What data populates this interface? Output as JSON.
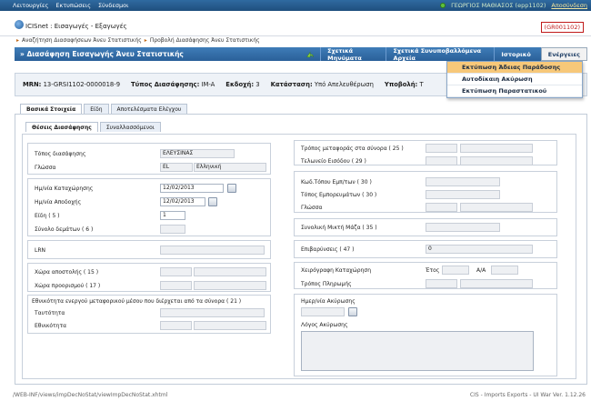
{
  "topbar": {
    "menus": [
      "Λειτουργίες",
      "Εκτυπώσεις",
      "Σύνδεσμοι"
    ],
    "user": "ΓΕΩΡΓΙΟΣ ΜΑΘΙΑΣΟΣ (epp1102)",
    "logout": "Αποσύνδεση"
  },
  "app": {
    "title": "ICISnet : Εισαγωγές - Εξαγωγές",
    "badge": "(GR001102)"
  },
  "breadcrumb": [
    "Αναζήτηση Διασαφήσεων Άνευ Στατιστικής",
    "Προβολή Διασάφησης Άνευ Στατιστικής"
  ],
  "pagebar": {
    "title": "» Διασάφηση Εισαγωγής Άνευ Στατιστικής",
    "buttons": [
      "Σχετικά Μηνύματα",
      "Σχετικά Συνυποβαλλόμενα Αρχεία",
      "Ιστορικό",
      "Ενέργειες"
    ]
  },
  "dropdown": [
    "Εκτύπωση Άδειας Παράδοσης",
    "Αυτοδίκαιη Ακύρωση",
    "Εκτύπωση Παραστατικού"
  ],
  "info": {
    "mrn_label": "MRN:",
    "mrn": "13-GRSI1102-0000018-9",
    "type_label": "Τύπος Διασάφησης:",
    "type": "IM-A",
    "version_label": "Εκδοχή:",
    "version": "3",
    "status_label": "Κατάσταση:",
    "status": "Υπό Απελευθέρωση",
    "submission_label": "Υποβολή:",
    "submission": "Τ"
  },
  "tabs": [
    "Βασικά Στοιχεία",
    "Είδη",
    "Αποτελέσματα Ελέγχου"
  ],
  "subtabs": [
    "Θέσεις Διασάφησης",
    "Συναλλασσόμενοι"
  ],
  "left": {
    "office_label": "Τόπος διασάφησης",
    "office": "ΕΛΕΥΣΙΝΑΣ",
    "lang_label": "Γλώσσα",
    "lang_code": "EL",
    "lang_name": "Ελληνική",
    "acceptance_label": "Ημ/νία Καταχώρησης",
    "acceptance_date": "12/02/2013",
    "release_label": "Ημ/νία Αποδοχής",
    "release_date": "12/02/2013",
    "items_label": "Είδη ( 5 )",
    "items": "1",
    "packages_label": "Σύνολο δεμάτων ( 6 )",
    "lrn_label": "LRN",
    "dispatch_label": "Χώρα αποστολής ( 15 )",
    "destination_label": "Χώρα προορισμού ( 17 )",
    "nationality_title": "Εθνικότητα ενεργού μεταφορικού μέσου που διέρχεται από τα σύνορα ( 21 )",
    "identity_label": "Ταυτότητα",
    "nationality_label": "Εθνικότητα"
  },
  "right": {
    "border_mode_label": "Τρόπος μεταφοράς στα σύνορα ( 25 )",
    "office_entry_label": "Τελωνείο Εισόδου ( 29 )",
    "goods_loc_code_label": "Κωδ.Τόπου Εμπ/των ( 30 )",
    "goods_loc_label": "Τόπος Εμπορευμάτων ( 30 )",
    "lang_label": "Γλώσσα",
    "gross_mass_label": "Συνολική Μικτή Μάζα ( 35 )",
    "charges_label": "Επιβαρύνσεις ( 47 )",
    "charges": "0",
    "paper_reg_label": "Χειρόγραφη Καταχώρηση",
    "year_label": "Έτος",
    "aa_label": "Α/Α",
    "payment_label": "Τρόπος Πληρωμής",
    "cancel_date_label": "Ημερ/νία Ακύρωσης",
    "cancel_reason_label": "Λόγος Ακύρωσης"
  },
  "footer": {
    "path": "/WEB-INF/views/impDecNoStat/viewImpDecNoStat.xhtml",
    "version": "CIS - Imports Exports - UI War Ver. 1.12.26"
  }
}
